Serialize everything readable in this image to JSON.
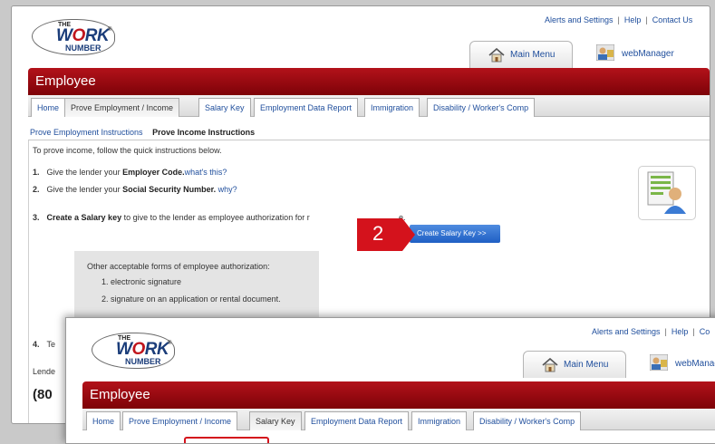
{
  "top_links": [
    "Alerts and Settings",
    "Help",
    "Contact Us"
  ],
  "top_links_clipped": [
    "Alerts and Settings",
    "Help",
    "Co"
  ],
  "logo": {
    "the": "THE",
    "work": "WORK",
    "number": "NUMBER",
    "reg": "®"
  },
  "nav": {
    "main_menu": "Main Menu",
    "webmanager": "webManager",
    "webmanager_clipped": "webManage"
  },
  "section_title": "Employee",
  "tabs": [
    "Home",
    "Prove Employment / Income",
    "Salary Key",
    "Employment Data Report",
    "Immigration",
    "Disability / Worker's Comp"
  ],
  "subnav": {
    "link": "Prove Employment Instructions",
    "current": "Prove Income Instructions"
  },
  "instructions": {
    "intro": "To prove income, follow the quick instructions below.",
    "step1": {
      "num": "1.",
      "pre": "Give the lender your ",
      "bold": "Employer Code.",
      "link": "what's this?"
    },
    "step2": {
      "num": "2.",
      "pre": "Give the lender your ",
      "bold": "Social Security Number.",
      "link": " why?"
    },
    "step3": {
      "num": "3.",
      "bold": "Create a Salary key",
      "post": " to give to the lender as employee authorization for r",
      "tail": "e."
    },
    "other_title": "Other acceptable forms of employee authorization:",
    "other1": "1.   electronic signature",
    "other2": "2.   signature on an application or rental document.",
    "step4": {
      "num": "4.",
      "text": "Te"
    },
    "lender_label": "Lende",
    "phone_partial": "(80"
  },
  "create_salary_key_button": "Create Salary Key >>",
  "callout_number": "2",
  "colors": {
    "brand_red": "#9b0a10",
    "link_blue": "#1f4e9c",
    "button_blue": "#2f6fd0"
  }
}
